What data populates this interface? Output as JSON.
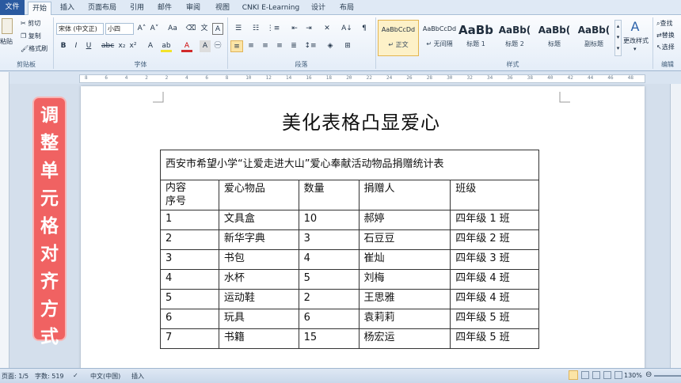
{
  "tabs": [
    "文件",
    "开始",
    "插入",
    "页面布局",
    "引用",
    "邮件",
    "审阅",
    "视图",
    "CNKI E-Learning",
    "设计",
    "布局"
  ],
  "clipboard": {
    "paste": "粘贴",
    "cut": "剪切",
    "copy": "复制",
    "format_painter": "格式刷",
    "label": "剪贴板"
  },
  "font_group": {
    "font_name": "宋体 (中文正)",
    "font_size": "小四",
    "label": "字体"
  },
  "paragraph_group": {
    "label": "段落"
  },
  "styles_group": {
    "label": "样式",
    "styles": [
      {
        "sample": "AaBbCcDd",
        "name": "↵ 正文"
      },
      {
        "sample": "AaBbCcDd",
        "name": "↵ 无间隔"
      },
      {
        "sample": "AaBb",
        "name": "标题 1"
      },
      {
        "sample": "AaBb(",
        "name": "标题 2"
      },
      {
        "sample": "AaBb(",
        "name": "标题"
      },
      {
        "sample": "AaBb(",
        "name": "副标题"
      }
    ],
    "change_styles": "更改样式"
  },
  "editing_group": {
    "find": "查找",
    "replace": "替换",
    "select": "选择",
    "label": "编辑"
  },
  "ruler_numbers": [
    "8",
    "6",
    "4",
    "2",
    "2",
    "4",
    "6",
    "8",
    "10",
    "12",
    "14",
    "16",
    "18",
    "20",
    "22",
    "24",
    "26",
    "28",
    "30",
    "32",
    "34",
    "36",
    "38",
    "40",
    "42",
    "44",
    "46",
    "48"
  ],
  "document": {
    "title": "美化表格凸显爱心",
    "table_caption": "西安市希望小学“让爱走进大山”爱心奉献活动物品捐赠统计表",
    "header": {
      "c1_top": "内容",
      "c1_bottom": "序号",
      "c2": "爱心物品",
      "c3": "数量",
      "c4": "捐赠人",
      "c5": "班级"
    },
    "rows": [
      [
        "1",
        "文具盒",
        "10",
        "郝婷",
        "四年级 1 班"
      ],
      [
        "2",
        "新华字典",
        "3",
        "石豆豆",
        "四年级 2 班"
      ],
      [
        "3",
        "书包",
        "4",
        "崔灿",
        "四年级 3 班"
      ],
      [
        "4",
        "水杯",
        "5",
        "刘梅",
        "四年级 4 班"
      ],
      [
        "5",
        "运动鞋",
        "2",
        "王思雅",
        "四年级 4 班"
      ],
      [
        "6",
        "玩具",
        "6",
        "袁莉莉",
        "四年级 5 班"
      ],
      [
        "7",
        "书籍",
        "15",
        "杨宏运",
        "四年级 5 班"
      ]
    ]
  },
  "banner_chars": [
    "调",
    "整",
    "单",
    "元",
    "格",
    "对",
    "齐",
    "方",
    "式"
  ],
  "status": {
    "page": "页面: 1/5",
    "words": "字数: 519",
    "language": "中文(中国)",
    "insert": "插入",
    "zoom": "130%"
  },
  "colors": {
    "banner": "#f06262",
    "file_tab": "#2a5aa0",
    "selected_style": "#fdf1c8"
  }
}
